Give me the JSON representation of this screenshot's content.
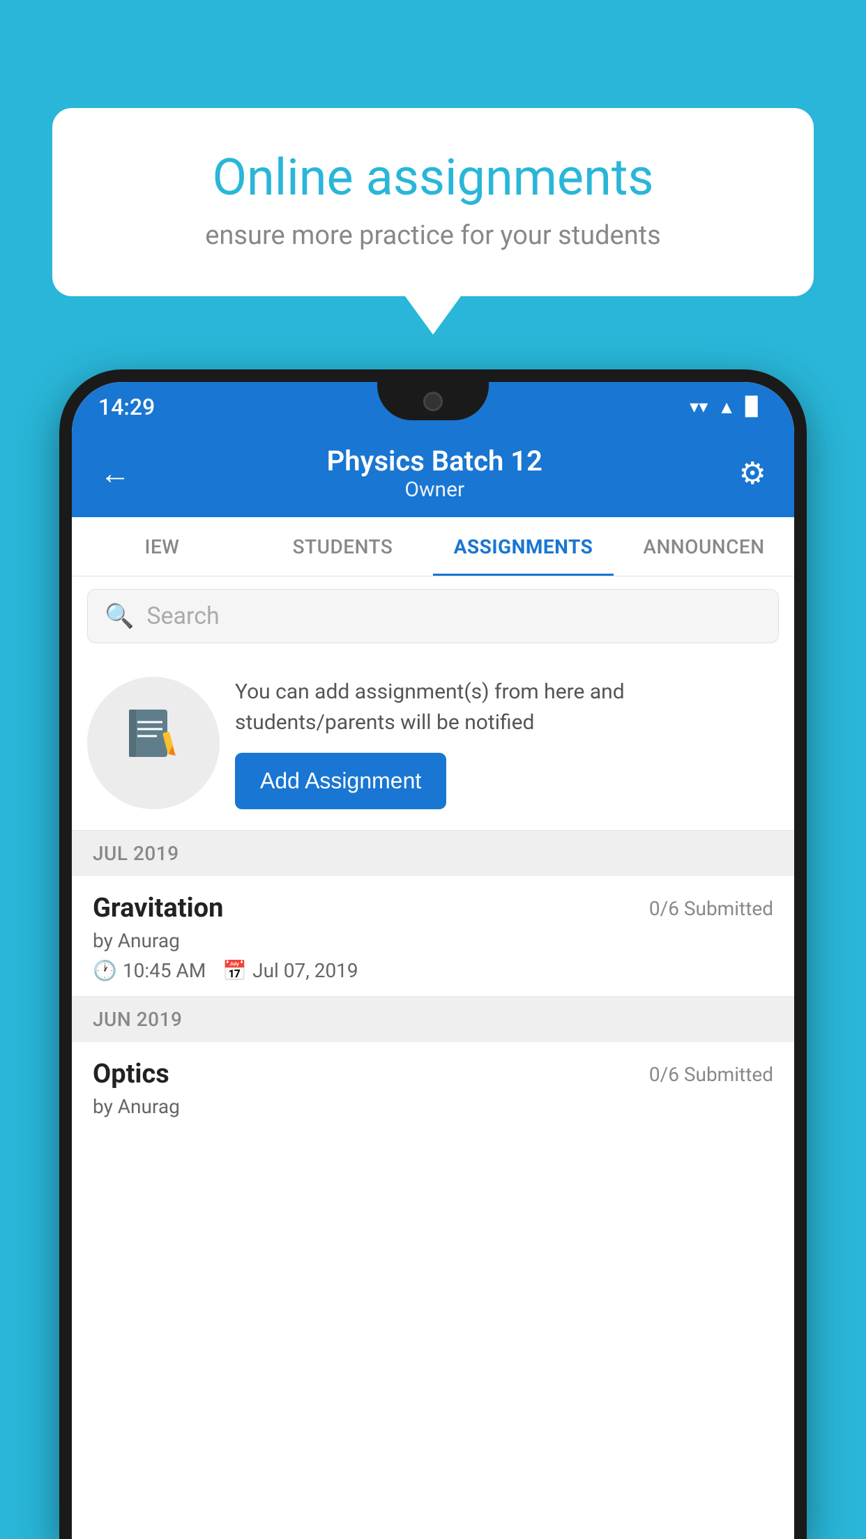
{
  "background_color": "#29b6d8",
  "speech_bubble": {
    "title": "Online assignments",
    "subtitle": "ensure more practice for your students"
  },
  "status_bar": {
    "time": "14:29",
    "wifi_icon": "▼",
    "signal_icon": "▲",
    "battery_icon": "▉"
  },
  "header": {
    "title": "Physics Batch 12",
    "subtitle": "Owner",
    "back_icon": "←",
    "settings_icon": "⚙"
  },
  "tabs": [
    {
      "label": "IEW",
      "active": false
    },
    {
      "label": "STUDENTS",
      "active": false
    },
    {
      "label": "ASSIGNMENTS",
      "active": true
    },
    {
      "label": "ANNOUNCEN",
      "active": false
    }
  ],
  "search": {
    "placeholder": "Search"
  },
  "promo": {
    "icon": "📓",
    "description": "You can add assignment(s) from here and students/parents will be notified",
    "button_label": "Add Assignment"
  },
  "sections": [
    {
      "month_label": "JUL 2019",
      "assignments": [
        {
          "name": "Gravitation",
          "submitted": "0/6 Submitted",
          "by": "by Anurag",
          "time": "10:45 AM",
          "date": "Jul 07, 2019"
        }
      ]
    },
    {
      "month_label": "JUN 2019",
      "assignments": [
        {
          "name": "Optics",
          "submitted": "0/6 Submitted",
          "by": "by Anurag",
          "time": "",
          "date": ""
        }
      ]
    }
  ]
}
